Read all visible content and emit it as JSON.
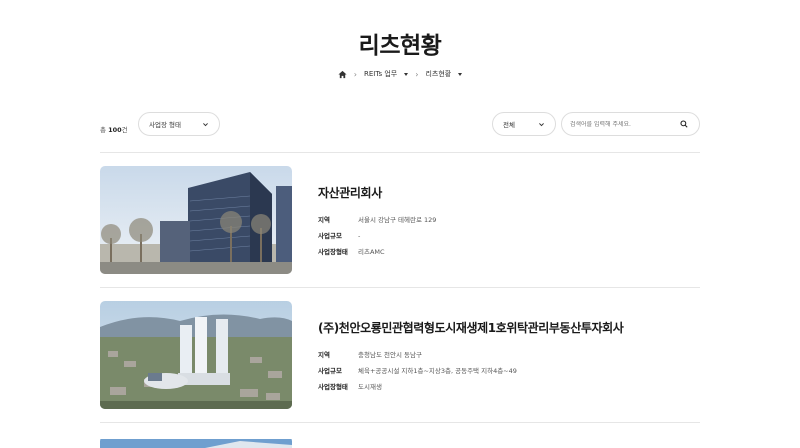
{
  "header": {
    "title": "리츠현황"
  },
  "breadcrumb": {
    "items": [
      "REITs 업무",
      "리츠현황"
    ]
  },
  "toolbar": {
    "count_prefix": "총",
    "count_value": "100",
    "count_suffix": "건",
    "type_select": "사업장 형태",
    "filter_select": "전체",
    "search_placeholder": "검색어를 입력해 주세요."
  },
  "labels": {
    "location": "지역",
    "scale": "사업규모",
    "type": "사업장형태"
  },
  "items": [
    {
      "title": "자산관리회사",
      "location": "서울시 강남구 테헤란로 129",
      "scale": "-",
      "type": "리츠AMC"
    },
    {
      "title": "(주)천안오룡민관협력형도시재생제1호위탁관리부동산투자회사",
      "location": "충청남도 천안시 동남구",
      "scale": "체육+공공시설 지하1층~지상3층, 공동주택 지하4층~49",
      "type": "도시재생"
    }
  ],
  "colors": {
    "text": "#1a1a1a",
    "border": "#dddddd"
  }
}
